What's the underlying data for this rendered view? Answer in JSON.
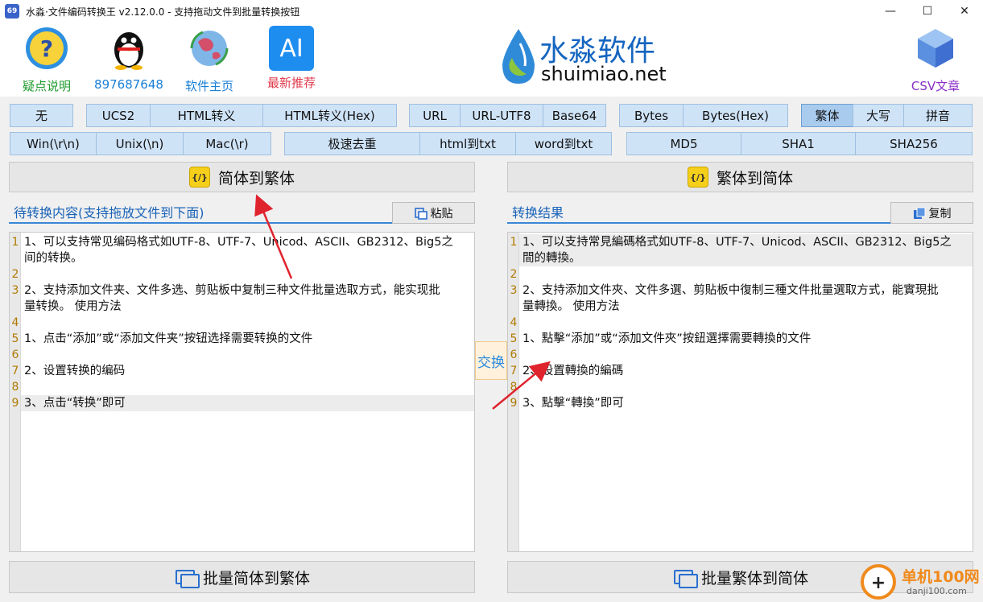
{
  "window": {
    "title": "水淼·文件编码转换王 v2.12.0.0 - 支持拖动文件到批量转换按钮",
    "app_icon_text": "69",
    "controls": [
      "—",
      "☐",
      "✕"
    ]
  },
  "header": {
    "items": [
      {
        "label": "疑点说明",
        "color": "#1f9a2e",
        "icon": "help-icon"
      },
      {
        "label": "897687648",
        "color": "#1a7fd6",
        "icon": "qq-penguin-icon"
      },
      {
        "label": "软件主页",
        "color": "#1a7fd6",
        "icon": "globe-icon"
      },
      {
        "label": "最新推荐",
        "color": "#e0384a",
        "icon": "ai-icon",
        "icon_text": "AI"
      }
    ],
    "logo_cn": "水淼软件",
    "logo_en": "shuimiao.net",
    "csv": {
      "label": "CSV文章",
      "color": "#8b2fc9",
      "icon": "cube-icon"
    }
  },
  "options_row1": {
    "group1": [
      "无"
    ],
    "group2": [
      "UCS2",
      "HTML转义",
      "HTML转义(Hex)"
    ],
    "group3": [
      "URL",
      "URL-UTF8",
      "Base64"
    ],
    "group4": [
      "Bytes",
      "Bytes(Hex)"
    ],
    "group5": [
      "繁体",
      "大写",
      "拼音"
    ],
    "active": "繁体"
  },
  "options_row2": {
    "group1": [
      "Win(\\r\\n)",
      "Unix(\\n)",
      "Mac(\\r)"
    ],
    "group2": [
      "极速去重",
      "html到txt",
      "word到txt"
    ],
    "group3": [
      "MD5",
      "SHA1",
      "SHA256"
    ]
  },
  "left": {
    "convert_label": "简体到繁体",
    "code_icon_text": "{/}",
    "section_title": "待转换内容(支持拖放文件到下面)",
    "paste_label": "粘贴",
    "lines": [
      "1、可以支持常见编码格式如UTF-8、UTF-7、Unicod、ASCII、GB2312、Big5之",
      "间的转换。",
      "",
      "2、支持添加文件夹、文件多选、剪贴板中复制三种文件批量选取方式，能实现批",
      "量转换。 使用方法",
      "",
      "1、点击“添加”或“添加文件夹”按钮选择需要转换的文件",
      "",
      "2、设置转换的编码",
      "",
      "3、点击“转换”即可"
    ],
    "line_numbers": [
      "1",
      "",
      "2",
      "3",
      "",
      "4",
      "5",
      "6",
      "7",
      "8",
      "9"
    ],
    "batch_label": "批量简体到繁体"
  },
  "swap_label": "交换",
  "right": {
    "convert_label": "繁体到简体",
    "code_icon_text": "{/}",
    "section_title": "转换结果",
    "copy_label": "复制",
    "lines": [
      "1、可以支持常見編碼格式如UTF-8、UTF-7、Unicod、ASCII、GB2312、Big5之",
      "間的轉換。",
      "",
      "2、支持添加文件夾、文件多選、剪貼板中復制三種文件批量選取方式，能實現批",
      "量轉換。 使用方法",
      "",
      "1、點擊“添加”或“添加文件夾”按鈕選擇需要轉換的文件",
      "",
      "2、設置轉換的編碼",
      "",
      "3、點擊“轉換”即可"
    ],
    "line_numbers": [
      "1",
      "",
      "2",
      "3",
      "",
      "4",
      "5",
      "6",
      "7",
      "8",
      "9"
    ],
    "batch_label": "批量繁体到简体"
  },
  "watermark": {
    "cn": "单机100网",
    "en": "danji100.com"
  }
}
